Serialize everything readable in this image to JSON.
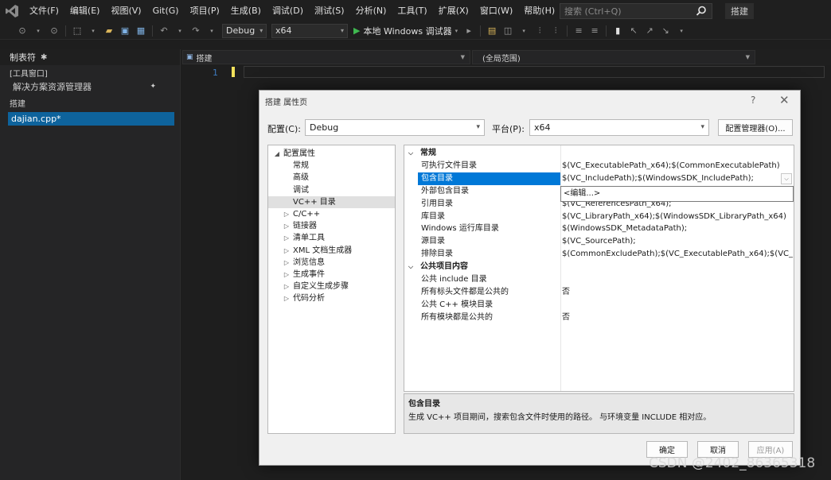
{
  "menubar": {
    "items": [
      "文件(F)",
      "编辑(E)",
      "视图(V)",
      "Git(G)",
      "项目(P)",
      "生成(B)",
      "调试(D)",
      "测试(S)",
      "分析(N)",
      "工具(T)",
      "扩展(X)",
      "窗口(W)",
      "帮助(H)"
    ],
    "search_placeholder": "搜索 (Ctrl+Q)",
    "build_tab": "搭建"
  },
  "toolbar": {
    "configuration": "Debug",
    "platform": "x64",
    "debugger_label": "本地 Windows 调试器"
  },
  "left_panel": {
    "header": "制表符",
    "tool_window": "[工具窗口]",
    "solution_explorer": "解决方案资源管理器",
    "group": "搭建",
    "file": "dajian.cpp*"
  },
  "editor": {
    "project_combo": "搭建",
    "scope_combo": "(全局范围)",
    "line_number": "1"
  },
  "dialog": {
    "title": "搭建 属性页",
    "help": "?",
    "close": "✕",
    "config_label": "配置(C):",
    "config_value": "Debug",
    "platform_label": "平台(P):",
    "platform_value": "x64",
    "config_manager": "配置管理器(O)...",
    "tree": [
      {
        "label": "配置属性",
        "expander": "◢",
        "level": 0
      },
      {
        "label": "常规",
        "expander": "",
        "level": 1
      },
      {
        "label": "高级",
        "expander": "",
        "level": 1
      },
      {
        "label": "调试",
        "expander": "",
        "level": 1
      },
      {
        "label": "VC++ 目录",
        "expander": "",
        "level": 1,
        "selected": true
      },
      {
        "label": "C/C++",
        "expander": "▷",
        "level": 1
      },
      {
        "label": "链接器",
        "expander": "▷",
        "level": 1
      },
      {
        "label": "清单工具",
        "expander": "▷",
        "level": 1
      },
      {
        "label": "XML 文档生成器",
        "expander": "▷",
        "level": 1
      },
      {
        "label": "浏览信息",
        "expander": "▷",
        "level": 1
      },
      {
        "label": "生成事件",
        "expander": "▷",
        "level": 1
      },
      {
        "label": "自定义生成步骤",
        "expander": "▷",
        "level": 1
      },
      {
        "label": "代码分析",
        "expander": "▷",
        "level": 1
      }
    ],
    "grid": [
      {
        "category": "常规"
      },
      {
        "name": "可执行文件目录",
        "value": "$(VC_ExecutablePath_x64);$(CommonExecutablePath)"
      },
      {
        "name": "包含目录",
        "value": "$(VC_IncludePath);$(WindowsSDK_IncludePath);",
        "selected": true
      },
      {
        "name": "外部包含目录",
        "value": ""
      },
      {
        "name": "引用目录",
        "value": "$(VC_ReferencesPath_x64);"
      },
      {
        "name": "库目录",
        "value": "$(VC_LibraryPath_x64);$(WindowsSDK_LibraryPath_x64)"
      },
      {
        "name": "Windows 运行库目录",
        "value": "$(WindowsSDK_MetadataPath);"
      },
      {
        "name": "源目录",
        "value": "$(VC_SourcePath);"
      },
      {
        "name": "排除目录",
        "value": "$(CommonExcludePath);$(VC_ExecutablePath_x64);$(VC_L"
      },
      {
        "category": "公共项目内容"
      },
      {
        "name": "公共 include 目录",
        "value": ""
      },
      {
        "name": "所有标头文件都是公共的",
        "value": "否"
      },
      {
        "name": "公共 C++ 模块目录",
        "value": ""
      },
      {
        "name": "所有模块都是公共的",
        "value": "否"
      }
    ],
    "dropdown_option": "<编辑...>",
    "description_title": "包含目录",
    "description_text": "生成 VC++ 项目期间，搜索包含文件时使用的路径。 与环境变量 INCLUDE 相对应。",
    "ok": "确定",
    "cancel": "取消",
    "apply": "应用(A)"
  },
  "watermark": "CSDN @2402_86365318"
}
